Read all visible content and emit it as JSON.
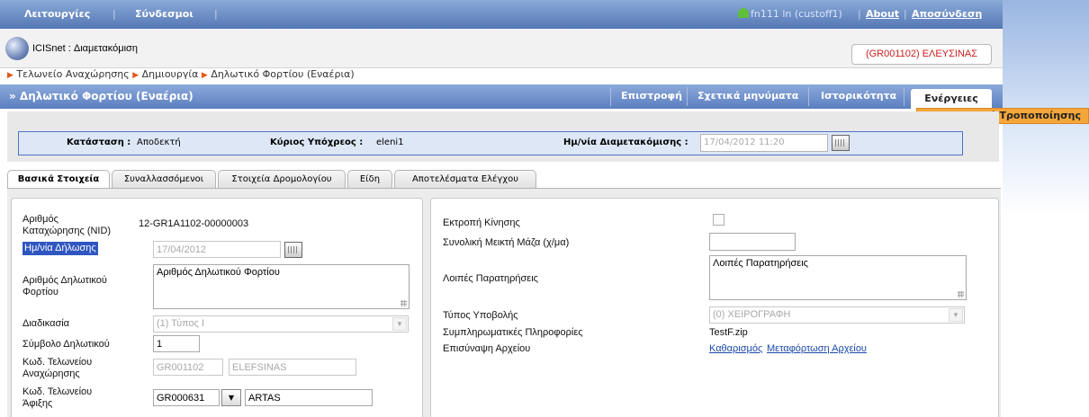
{
  "topbar": {
    "menu": [
      "Λειτουργίες",
      "Σύνδεσμοι"
    ],
    "user": "fn111 ln (custoff1)",
    "about": "About",
    "logout": "Αποσύνδεση"
  },
  "app": {
    "name": "ICISnet : Διαμετακόμιση",
    "office": "(GR001102) ΕΛΕΥΣΙΝΑΣ"
  },
  "breadcrumb": [
    "Τελωνείο Αναχώρησης",
    "Δημιουργία",
    "Δηλωτικό Φορτίου (Εναέρια)"
  ],
  "titlebar": {
    "title": "» Δηλωτικό Φορτίου (Εναέρια)",
    "buttons": [
      "Επιστροφή",
      "Σχετικά μηνύματα",
      "Ιστορικότητα"
    ],
    "actions": "Ενέργειες",
    "actions_menu": [
      "Αποδοχή Τροποποίησης"
    ]
  },
  "status": {
    "state_label": "Κατάσταση :",
    "state_value": "Αποδεκτή",
    "owner_label": "Κύριος Υπόχρεος :",
    "owner_value": "eleni1",
    "date_label": "Ημ/νία Διαμετακόμισης :",
    "date_value": "17/04/2012 11:20"
  },
  "tabs": [
    "Βασικά Στοιχεία",
    "Συναλλασσόμενοι",
    "Στοιχεία Δρομολογίου",
    "Είδη",
    "Αποτελέσματα Ελέγχου"
  ],
  "left": {
    "nid_label": "Αριθμός Καταχώρησης (NID)",
    "nid_value": "12-GR1A1102-00000003",
    "decl_date_label": "Ημ/νία Δήλωσης",
    "decl_date_value": "17/04/2012",
    "decl_no_label": "Αριθμός Δηλωτικού Φορτίου",
    "decl_no_value": "Αριθμός Δηλωτικού Φορτίου",
    "procedure_label": "Διαδικασία",
    "procedure_value": "(1) Τύπος Ι",
    "symbol_label": "Σύμβολο Δηλωτικού",
    "symbol_value": "1",
    "dep_office_label": "Κωδ. Τελωνείου Αναχώρησης",
    "dep_office_code": "GR001102",
    "dep_office_name": "ELEFSINAS",
    "arr_office_label": "Κωδ. Τελωνείου Άφιξης",
    "arr_office_code": "GR000631",
    "arr_office_name": "ARTAS"
  },
  "right": {
    "diversion_label": "Εκτροπή Κίνησης",
    "gross_mass_label": "Συνολική Μεικτή Μάζα (χ/μα)",
    "gross_mass_value": "",
    "remarks_label": "Λοιπές Παρατηρήσεις",
    "remarks_value": "Λοιπές Παρατηρήσεις",
    "submission_label": "Τύπος Υποβολής",
    "submission_value": "(0) ΧΕΙΡΟΓΡΑΦΗ",
    "suppl_label": "Συμπληρωματικές Πληροφορίες",
    "suppl_value": "TestF.zip",
    "attach_label": "Επισύναψη Αρχείου",
    "attach_clear": "Καθαρισμός",
    "attach_upload": "Μεταφόρτωση Αρχείου"
  }
}
